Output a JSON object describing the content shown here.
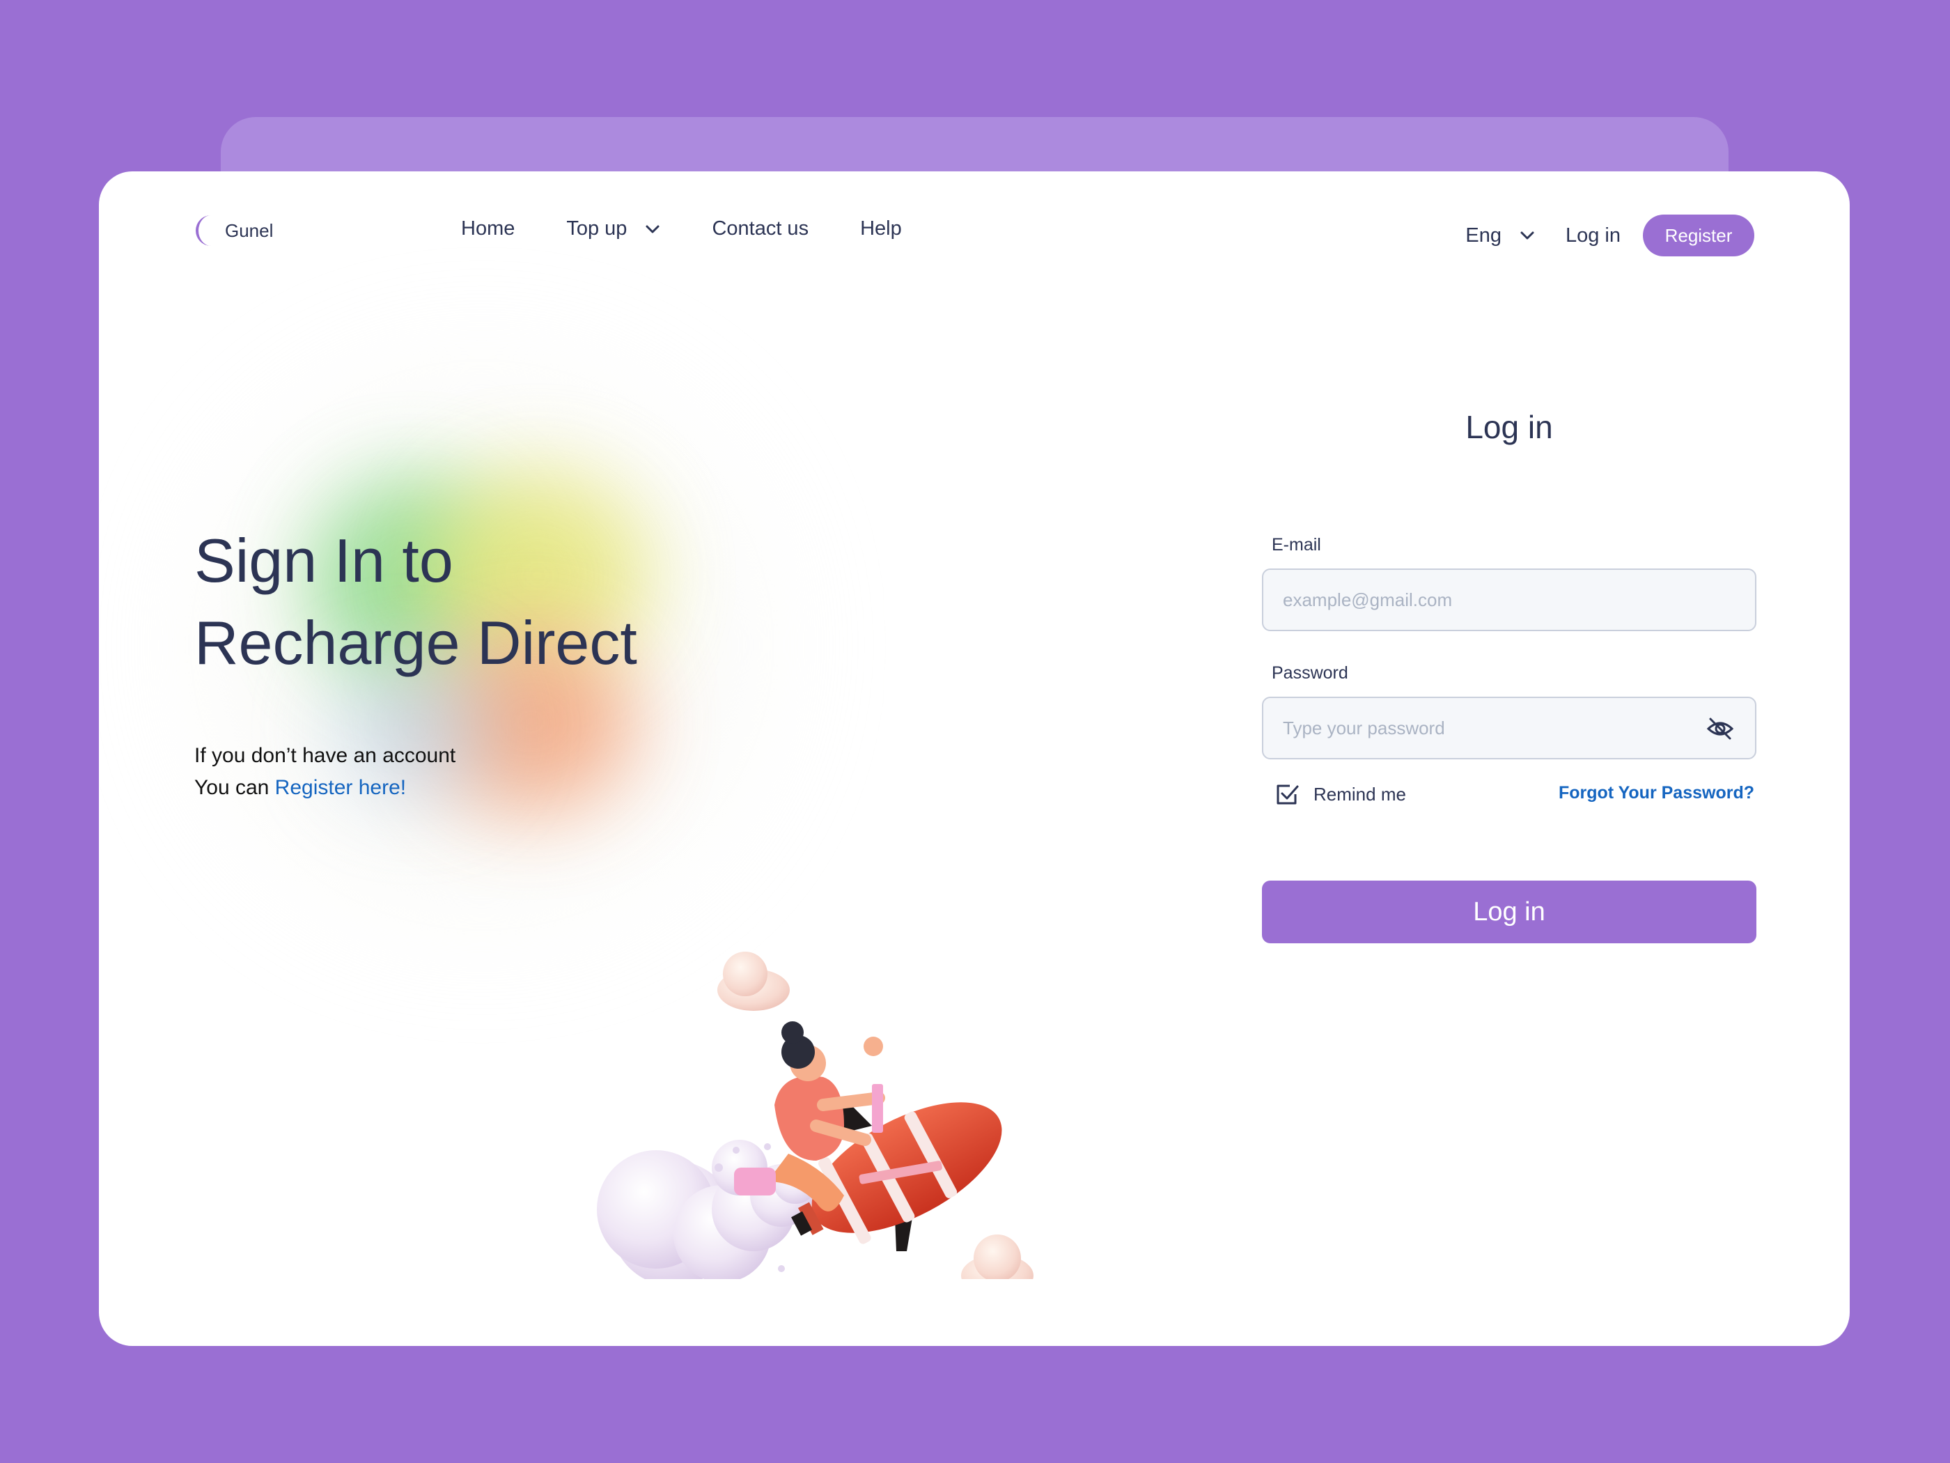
{
  "brand": {
    "name": "Gunel",
    "accent": "#9a6fd3"
  },
  "nav": {
    "items": [
      {
        "label": "Home"
      },
      {
        "label": "Top up",
        "has_dropdown": true
      },
      {
        "label": "Contact us"
      },
      {
        "label": "Help"
      }
    ]
  },
  "header": {
    "language": "Eng",
    "login_label": "Log in",
    "register_label": "Register"
  },
  "hero": {
    "title_line1": "Sign In to",
    "title_line2": "Recharge Direct",
    "sub_line1": "If you don’t have an account",
    "sub_line2_prefix": "You can ",
    "register_link": "Register here!"
  },
  "form": {
    "title": "Log in",
    "email_label": "E-mail",
    "email_placeholder": "example@gmail.com",
    "password_label": "Password",
    "password_placeholder": "Type your password",
    "remember_label": "Remind me",
    "remember_checked": true,
    "forgot_label": "Forgot Your Password?",
    "submit_label": "Log in"
  }
}
